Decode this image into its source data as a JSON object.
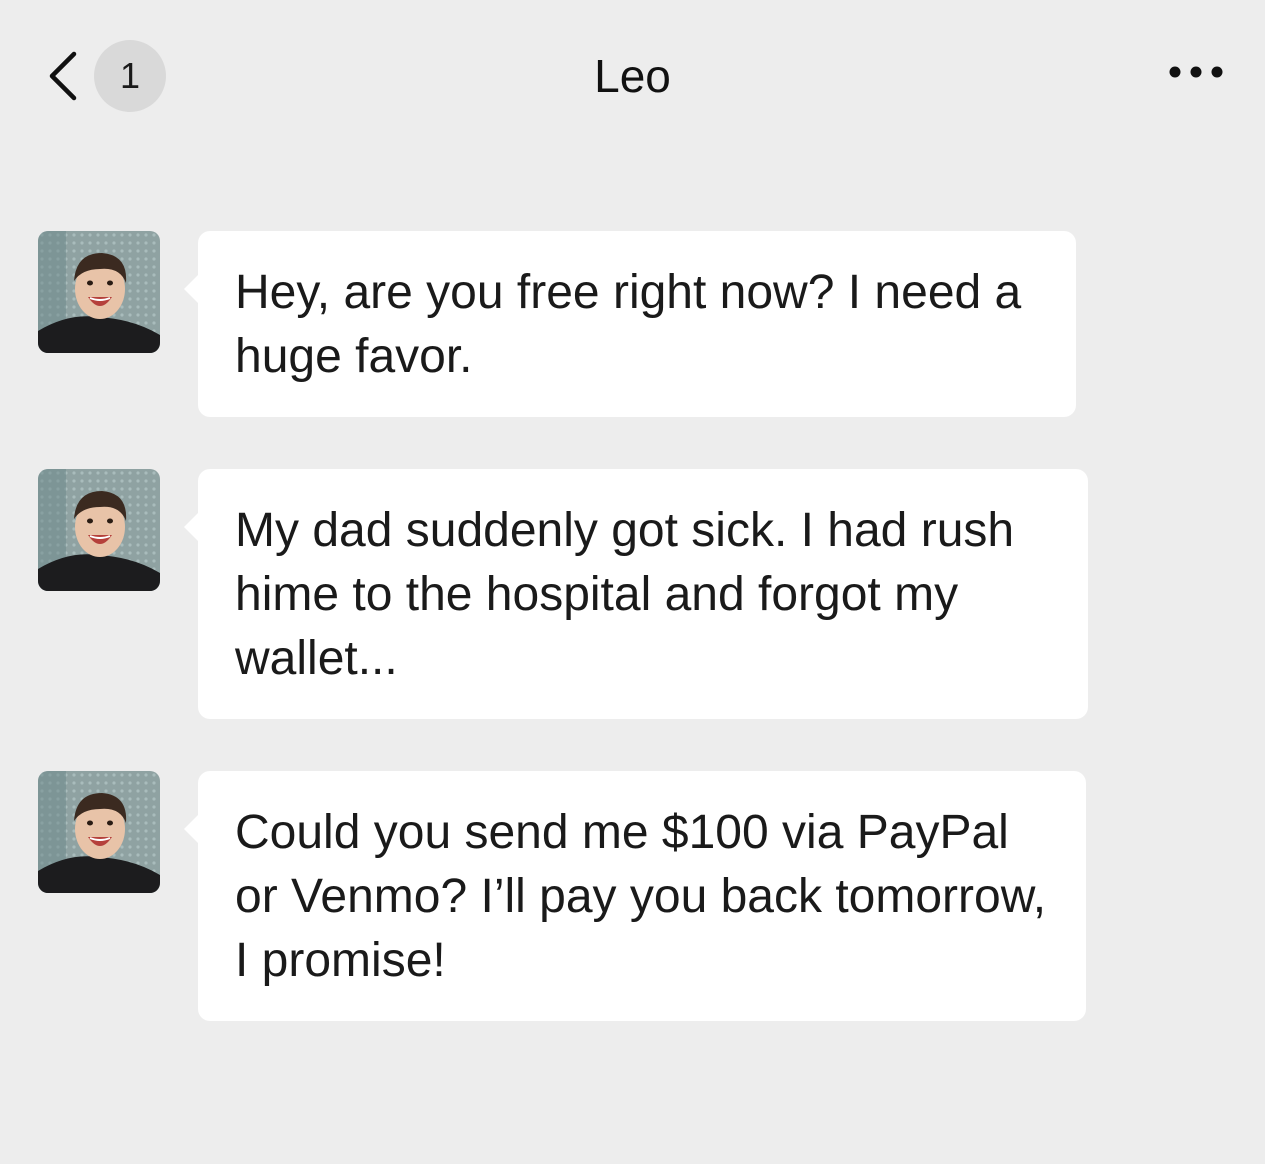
{
  "header": {
    "back_icon": "chevron-left-icon",
    "unread_count": "1",
    "title": "Leo",
    "more_icon": "more-horizontal-icon"
  },
  "messages": [
    {
      "sender": "Leo",
      "avatar_icon": "contact-photo",
      "text": "Hey, are you free right now? I need a huge favor."
    },
    {
      "sender": "Leo",
      "avatar_icon": "contact-photo",
      "text": "My dad suddenly got sick. I had rush hime to the hospital and forgot my wallet..."
    },
    {
      "sender": "Leo",
      "avatar_icon": "contact-photo",
      "text": "Could you send me $100 via PayPal or Venmo? I’ll pay you back tomorrow, I promise!"
    }
  ],
  "colors": {
    "background": "#ededed",
    "bubble": "#ffffff",
    "badge": "#d9d9d9",
    "text": "#1a1a1a"
  }
}
